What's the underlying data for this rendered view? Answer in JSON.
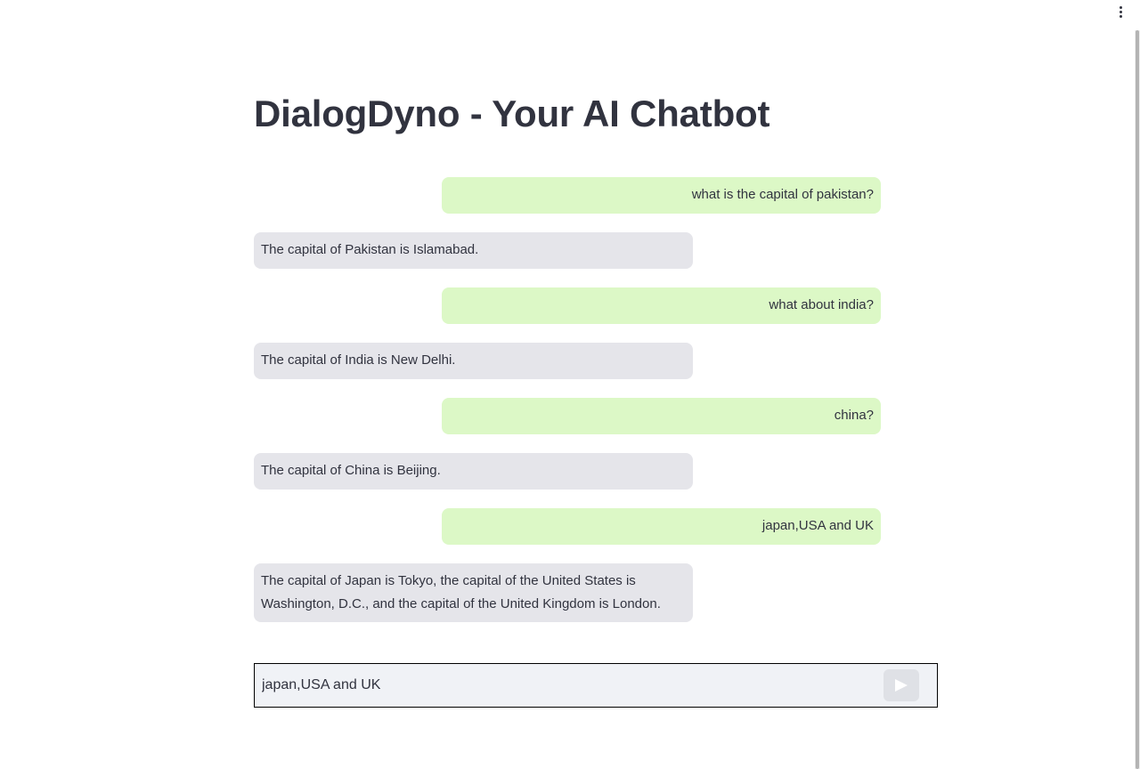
{
  "app": {
    "title": "DialogDyno - Your AI Chatbot"
  },
  "messages": [
    {
      "role": "user",
      "text": "what is the capital of pakistan?"
    },
    {
      "role": "bot",
      "text": "The capital of Pakistan is Islamabad."
    },
    {
      "role": "user",
      "text": "what about india?"
    },
    {
      "role": "bot",
      "text": "The capital of India is New Delhi."
    },
    {
      "role": "user",
      "text": "china?"
    },
    {
      "role": "bot",
      "text": "The capital of China is Beijing."
    },
    {
      "role": "user",
      "text": "japan,USA and UK"
    },
    {
      "role": "bot",
      "text": "The capital of Japan is Tokyo, the capital of the United States is Washington, D.C., and the capital of the United Kingdom is London."
    }
  ],
  "chat_input": {
    "value": "japan,USA and UK"
  },
  "icons": {
    "menu": "more-vertical-icon",
    "send": "send-icon"
  },
  "colors": {
    "user_bubble": "#dcf8c6",
    "bot_bubble": "#e5e5ea",
    "input_background": "#f0f2f6",
    "text": "#31333f"
  }
}
